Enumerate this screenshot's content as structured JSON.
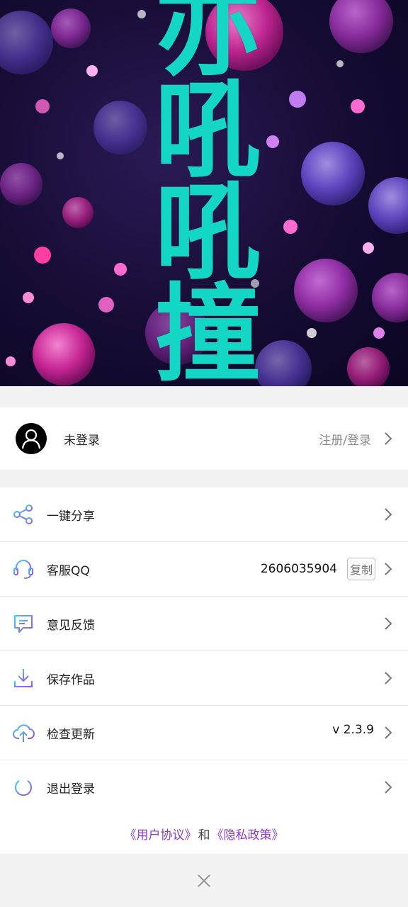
{
  "banner": {
    "title_text": "亦吼吼撞",
    "title_color": "#14d6c4"
  },
  "profile": {
    "avatar_icon": "user-icon",
    "name": "未登录",
    "login_label": "注册/登录"
  },
  "menu": {
    "items": [
      {
        "label": "一键分享",
        "icon": "share-icon"
      },
      {
        "label": "客服QQ",
        "icon": "headset-icon",
        "value": "2606035904",
        "copy_label": "复制"
      },
      {
        "label": "意见反馈",
        "icon": "feedback-icon"
      },
      {
        "label": "保存作品",
        "icon": "download-icon"
      },
      {
        "label": "检查更新",
        "icon": "cloud-upload-icon",
        "value": "v 2.3.9"
      },
      {
        "label": "退出登录",
        "icon": "power-icon"
      }
    ]
  },
  "footer": {
    "user_agreement": "《用户协议》",
    "and": "和",
    "privacy_policy": "《隐私政策》"
  },
  "colors": {
    "icon_gradient_start": "#36d1f0",
    "icon_gradient_end": "#a349e8",
    "link": "#8a3bc9"
  }
}
